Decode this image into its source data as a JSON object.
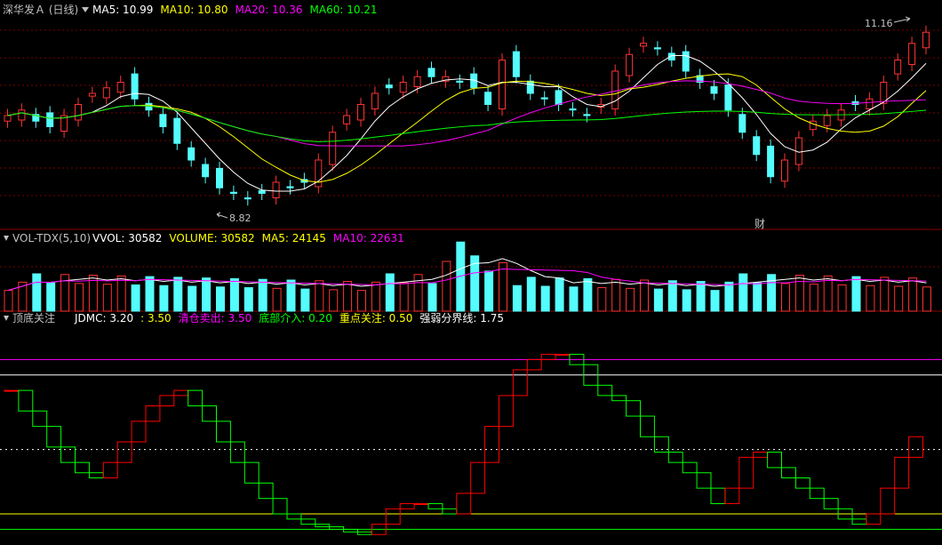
{
  "colors": {
    "up": "#ff3232",
    "down": "#54fcfc",
    "ma5": "#ffffff",
    "ma10": "#ffff00",
    "ma20": "#ff00ff",
    "ma60": "#00ff00",
    "grid": "#8b0000",
    "text": "#c0c0c0",
    "jdmc_red": "#ff0000",
    "jdmc_green": "#00ff00"
  },
  "price_panel": {
    "title": "深华发Ａ (日线)",
    "collapse_icon": "down-triangle-icon",
    "indicators": [
      {
        "label": "MA5: 10.99",
        "color": "#ffffff"
      },
      {
        "label": "MA10: 10.80",
        "color": "#ffff00"
      },
      {
        "label": "MA20: 10.36",
        "color": "#ff00ff"
      },
      {
        "label": "MA60: 10.21",
        "color": "#00ff00"
      }
    ],
    "high_marker": "11.16",
    "low_marker": "8.82",
    "event_marker": "财"
  },
  "volume_panel": {
    "indicator_name": "VOL-TDX(5,10)",
    "indicators": [
      {
        "label": "VVOL: 30582",
        "color": "#ffffff"
      },
      {
        "label": "VOLUME: 30582",
        "color": "#ffff00"
      },
      {
        "label": "MA5: 24145",
        "color": "#ffff00"
      },
      {
        "label": "MA10: 22631",
        "color": "#ff00ff"
      }
    ]
  },
  "signal_panel": {
    "indicator_name": "顶底关注",
    "indicators": [
      {
        "label": "JDMC: 3.20",
        "color": "#ffffff"
      },
      {
        "label": ": 3.50",
        "color": "#ffff00"
      },
      {
        "label": "清仓卖出: 3.50",
        "color": "#ff00ff"
      },
      {
        "label": "底部介入: 0.20",
        "color": "#00ff00"
      },
      {
        "label": "重点关注: 0.50",
        "color": "#ffff00"
      },
      {
        "label": "强弱分界线: 1.75",
        "color": "#ffffff"
      }
    ]
  }
}
